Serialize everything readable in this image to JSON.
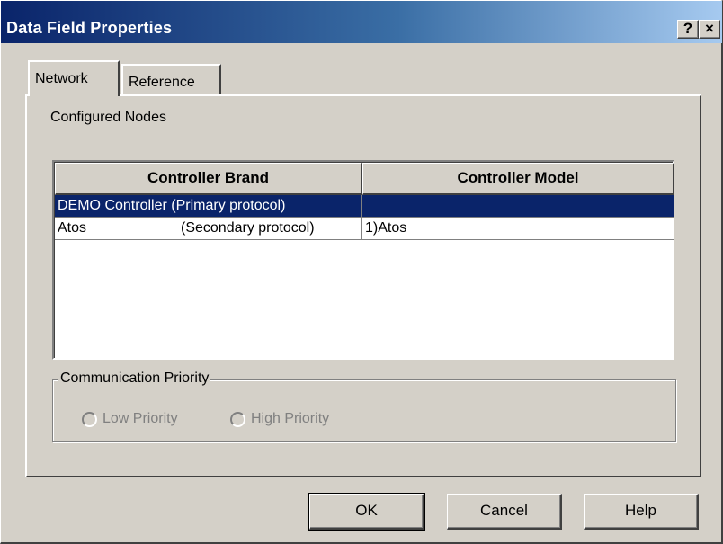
{
  "window": {
    "title": "Data Field Properties",
    "help_button": "?",
    "close_button": "×"
  },
  "tabs": [
    {
      "label": "Network",
      "active": true
    },
    {
      "label": "Reference",
      "active": false
    }
  ],
  "network": {
    "configured_nodes_label": "Configured Nodes",
    "grid": {
      "columns": [
        "Controller Brand",
        "Controller Model"
      ],
      "rows": [
        {
          "brand": "DEMO Controller",
          "protocol": "(Primary protocol)",
          "model": "",
          "selected": true
        },
        {
          "brand": "Atos",
          "protocol": "(Secondary protocol)",
          "model": "1)Atos",
          "selected": false
        }
      ]
    },
    "communication_priority": {
      "legend": "Communication Priority",
      "options": [
        {
          "label": "Low Priority",
          "enabled": false,
          "checked": false
        },
        {
          "label": "High Priority",
          "enabled": false,
          "checked": false
        }
      ]
    }
  },
  "buttons": {
    "ok": "OK",
    "cancel": "Cancel",
    "help": "Help"
  },
  "colors": {
    "title_gradient_start": "#0a246a",
    "title_gradient_end": "#a6caf0",
    "selection": "#0a246a",
    "face": "#d4d0c8"
  }
}
